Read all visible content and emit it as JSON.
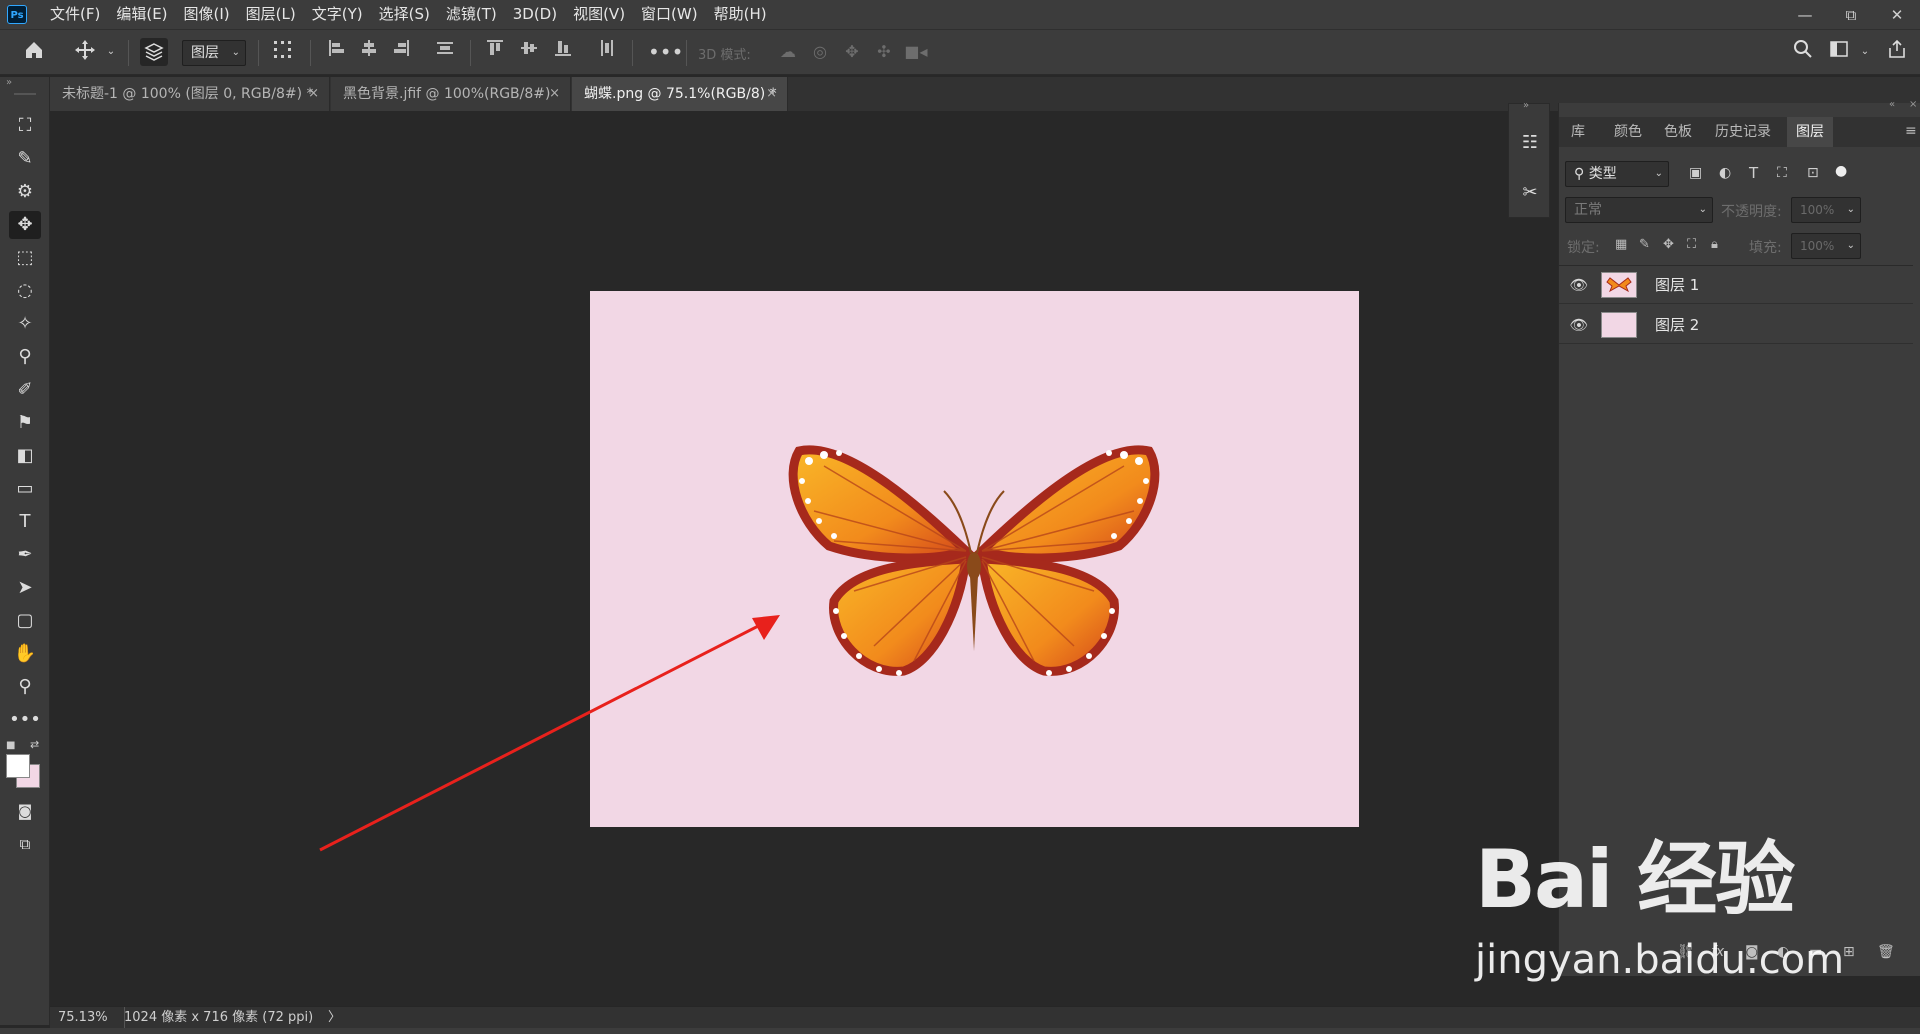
{
  "app": {
    "logo": "Ps"
  },
  "menu": [
    "文件(F)",
    "编辑(E)",
    "图像(I)",
    "图层(L)",
    "文字(Y)",
    "选择(S)",
    "滤镜(T)",
    "3D(D)",
    "视图(V)",
    "窗口(W)",
    "帮助(H)"
  ],
  "window_controls": {
    "minimize": "—",
    "restore": "⧉",
    "close": "✕"
  },
  "options": {
    "auto_select_target": "图层",
    "mode_3d_label": "3D 模式:"
  },
  "tabs": [
    {
      "label": "未标题-1 @ 100% (图层 0, RGB/8#) *"
    },
    {
      "label": "黑色背景.jfif @ 100%(RGB/8#)"
    },
    {
      "label": "蝴蝶.png @ 75.1%(RGB/8) *"
    }
  ],
  "status": {
    "zoom": "75.13%",
    "doc_info": "1024 像素 x 716 像素 (72 ppi)",
    "arrow": "〉"
  },
  "panel": {
    "tabs": [
      "库",
      "颜色",
      "色板",
      "历史记录",
      "图层"
    ],
    "filter_kind": "类型",
    "blend_mode": "正常",
    "opacity_label": "不透明度:",
    "opacity_value": "100%",
    "lock_label": "锁定:",
    "fill_label": "填充:",
    "fill_value": "100%",
    "layers": [
      {
        "name": "图层 1"
      },
      {
        "name": "图层 2"
      }
    ]
  },
  "colors": {
    "canvas_bg": "#f2d7e5",
    "arrow": "#e8211c",
    "foreground": "#ffffff",
    "background": "#f2d7e5"
  },
  "watermark": {
    "logo": "Bai 经验",
    "url": "jingyan.baidu.com"
  }
}
